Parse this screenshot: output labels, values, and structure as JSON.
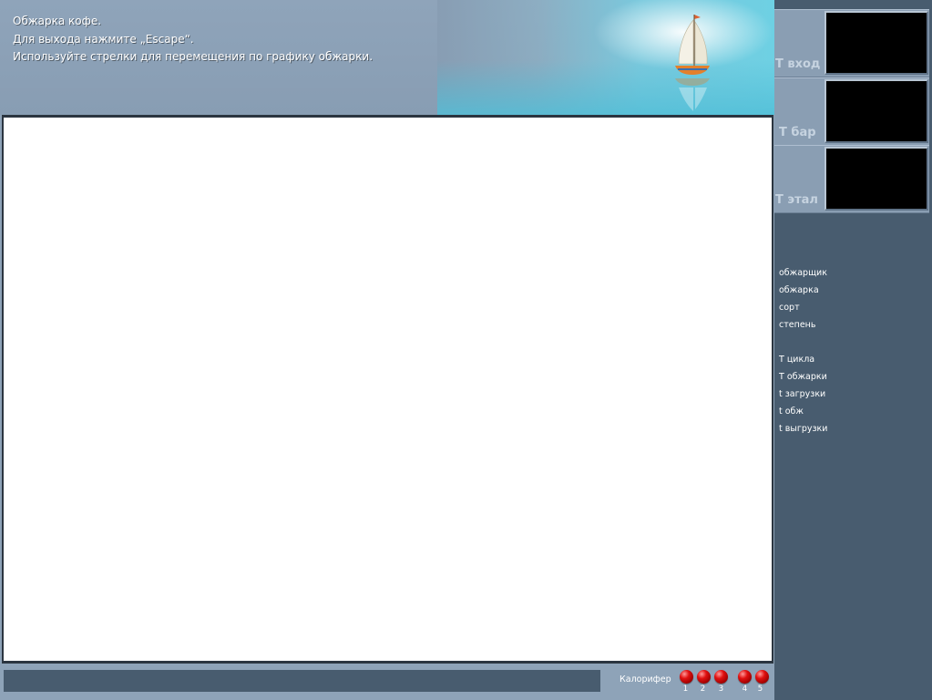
{
  "header": {
    "line1": "Обжарка кофе.",
    "line2": "Для выхода нажмите „Escape“.",
    "line3": "Используйте стрелки для перемещения по графику обжарки."
  },
  "temperatures": [
    {
      "label": "T вход",
      "value": ""
    },
    {
      "label": "T бар",
      "value": ""
    },
    {
      "label": "T этал",
      "value": ""
    }
  ],
  "roast_info": [
    "обжарщик",
    "обжарка",
    "сорт",
    "степень"
  ],
  "timing_info": [
    "T цикла",
    "T обжарки",
    "t загрузки",
    "t обж",
    "t выгрузки"
  ],
  "status": {
    "text": "",
    "heater_label": "Калорифер",
    "heater_indicators": [
      {
        "number": "1",
        "color": "#e01010"
      },
      {
        "number": "2",
        "color": "#e01010"
      },
      {
        "number": "3",
        "color": "#e01010"
      },
      {
        "number": "4",
        "color": "#e01010"
      },
      {
        "number": "5",
        "color": "#e01010"
      }
    ]
  },
  "colors": {
    "panel_dark": "#485c6f",
    "panel_light": "#8a9eb3",
    "display_bg": "#000000",
    "indicator_red": "#e01010"
  },
  "icons": {
    "header_art": "sailboat-icon"
  }
}
